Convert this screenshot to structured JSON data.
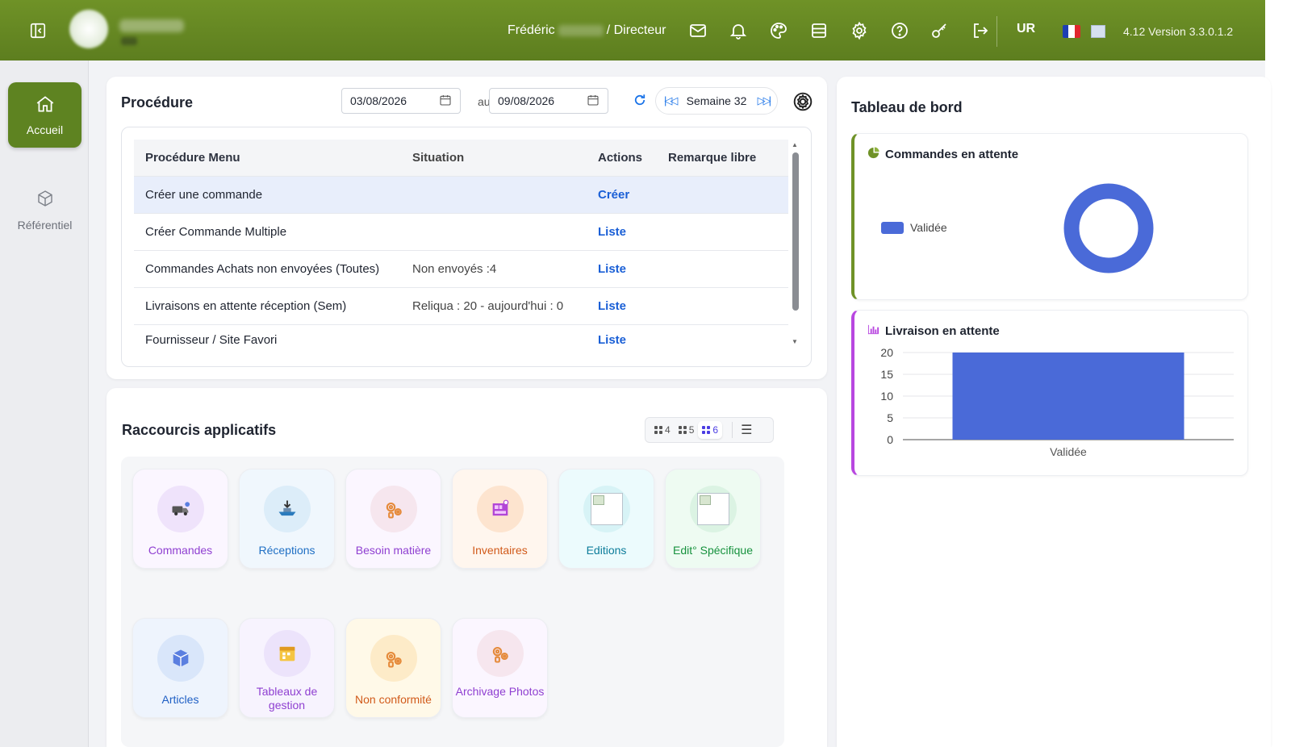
{
  "topbar": {
    "user_first_name": "Frédéric",
    "user_role": "/ Directeur",
    "lang": "UR",
    "version": "4.12 Version 3.3.0.1.2",
    "icons": [
      "mail-icon",
      "bell-icon",
      "palette-icon",
      "database-icon",
      "gear-icon",
      "help-icon",
      "key-icon",
      "logout-icon"
    ]
  },
  "sidebar": {
    "items": [
      {
        "label": "Accueil",
        "icon": "home-icon",
        "active": true
      },
      {
        "label": "Référentiel",
        "icon": "cube-icon",
        "active": false
      }
    ]
  },
  "procedure": {
    "title": "Procédure",
    "date_from": "03/08/2026",
    "date_sep": "au",
    "date_to": "09/08/2026",
    "week_label": "Semaine 32",
    "columns": [
      "Procédure Menu",
      "Situation",
      "Actions",
      "Remarque libre"
    ],
    "rows": [
      {
        "menu": "Créer une commande",
        "situation": "",
        "action": "Créer",
        "remark": ""
      },
      {
        "menu": "Créer Commande Multiple",
        "situation": "",
        "action": "Liste",
        "remark": ""
      },
      {
        "menu": "Commandes Achats non envoyées (Toutes)",
        "situation": "Non envoyés :4",
        "action": "Liste",
        "remark": ""
      },
      {
        "menu": "Livraisons en attente réception (Sem)",
        "situation": "Reliqua : 20 - aujourd'hui : 0",
        "action": "Liste",
        "remark": ""
      },
      {
        "menu": "Fournisseur / Site Favori",
        "situation": "",
        "action": "Liste",
        "remark": ""
      }
    ]
  },
  "shortcuts": {
    "title": "Raccourcis applicatifs",
    "grid_options": [
      "4",
      "5",
      "6"
    ],
    "grid_selected": "6",
    "tiles": [
      {
        "label": "Commandes",
        "color": "#8f3fd1"
      },
      {
        "label": "Réceptions",
        "color": "#1f6fc4"
      },
      {
        "label": "Besoin matière",
        "color": "#8f3fd1"
      },
      {
        "label": "Inventaires",
        "color": "#d15a1a"
      },
      {
        "label": "Editions",
        "color": "#0c7c9a"
      },
      {
        "label": "Edit° Spécifique",
        "color": "#17923e"
      },
      {
        "label": "Articles",
        "color": "#1f5fc4"
      },
      {
        "label": "Tableaux de gestion",
        "color": "#8f3fd1"
      },
      {
        "label": "Non conformité",
        "color": "#d15a1a"
      },
      {
        "label": "Archivage Photos",
        "color": "#8f3fd1"
      }
    ]
  },
  "dashboard": {
    "title": "Tableau de bord",
    "widget1": {
      "title": "Commandes en attente",
      "legend": "Validée"
    },
    "widget2": {
      "title": "Livraison en attente"
    }
  },
  "chart_data": [
    {
      "type": "pie",
      "title": "Commandes en attente",
      "categories": [
        "Validée"
      ],
      "values": [
        1
      ],
      "colors": [
        "#4a6ad8"
      ],
      "legend": "left"
    },
    {
      "type": "bar",
      "title": "Livraison en attente",
      "categories": [
        "Validée"
      ],
      "values": [
        20
      ],
      "ylim": [
        0,
        20
      ],
      "yticks": [
        "0",
        "5",
        "10",
        "15",
        "20"
      ],
      "colors": [
        "#4a6ad8"
      ],
      "grid": true
    }
  ]
}
